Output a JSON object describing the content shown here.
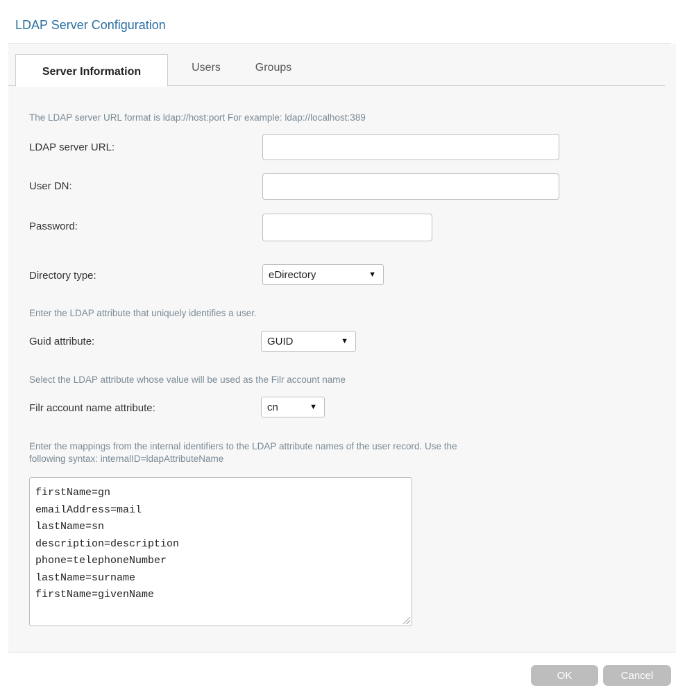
{
  "dialog": {
    "title": "LDAP Server Configuration"
  },
  "tabs": [
    {
      "label": "Server Information",
      "active": true
    },
    {
      "label": "Users",
      "active": false
    },
    {
      "label": "Groups",
      "active": false
    }
  ],
  "server": {
    "url_hint": "The LDAP server URL format is ldap://host:port For example: ldap://localhost:389",
    "url_label": "LDAP server URL:",
    "url_value": "",
    "user_dn_label": "User DN:",
    "user_dn_value": "",
    "password_label": "Password:",
    "password_value": "",
    "directory_type_label": "Directory type:",
    "directory_type_value": "eDirectory",
    "guid_hint": "Enter the LDAP attribute that uniquely identifies a user.",
    "guid_label": "Guid attribute:",
    "guid_value": "GUID",
    "account_hint": "Select the LDAP attribute whose value will be used as the Filr account name",
    "account_label": "Filr account name attribute:",
    "account_value": "cn",
    "mapping_hint_line1": "Enter the mappings from the internal identifiers to the LDAP attribute names of the user record. Use the",
    "mapping_hint_line2": "following syntax: internalID=ldapAttributeName",
    "mappings": "firstName=gn\nemailAddress=mail\nlastName=sn\ndescription=description\nphone=telephoneNumber\nlastName=surname\nfirstName=givenName"
  },
  "buttons": {
    "ok": "OK",
    "cancel": "Cancel"
  },
  "icons": {
    "dropdown": "dropdown-arrow-icon",
    "resize": "resize-grip-icon"
  }
}
